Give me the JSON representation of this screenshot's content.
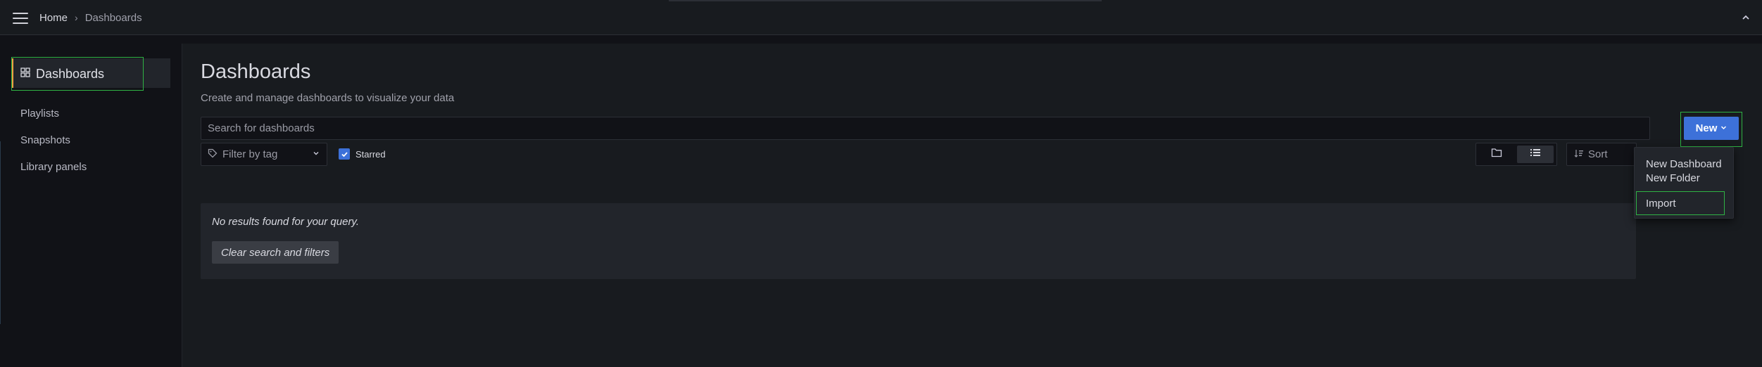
{
  "topbar": {
    "breadcrumb": {
      "home": "Home",
      "separator": "›",
      "current": "Dashboards"
    }
  },
  "sidebar": {
    "section_title": "Dashboards",
    "items": [
      {
        "label": "Playlists"
      },
      {
        "label": "Snapshots"
      },
      {
        "label": "Library panels"
      }
    ]
  },
  "main": {
    "title": "Dashboards",
    "subtitle": "Create and manage dashboards to visualize your data",
    "search": {
      "placeholder": "Search for dashboards",
      "value": ""
    },
    "new_button": {
      "label": "New"
    },
    "tag_filter": {
      "placeholder": "Filter by tag"
    },
    "starred": {
      "label": "Starred",
      "checked": true
    },
    "sort": {
      "placeholder": "Sort"
    },
    "results": {
      "empty_message": "No results found for your query.",
      "clear_label": "Clear search and filters"
    }
  },
  "new_menu": {
    "items": [
      {
        "label": "New Dashboard"
      },
      {
        "label": "New Folder"
      },
      {
        "label": "Import"
      }
    ]
  },
  "colors": {
    "background": "#111217",
    "panel": "#181b1f",
    "primary": "#3d71d9",
    "highlight_outline": "#2fb344",
    "active_accent": "#f0a040"
  }
}
